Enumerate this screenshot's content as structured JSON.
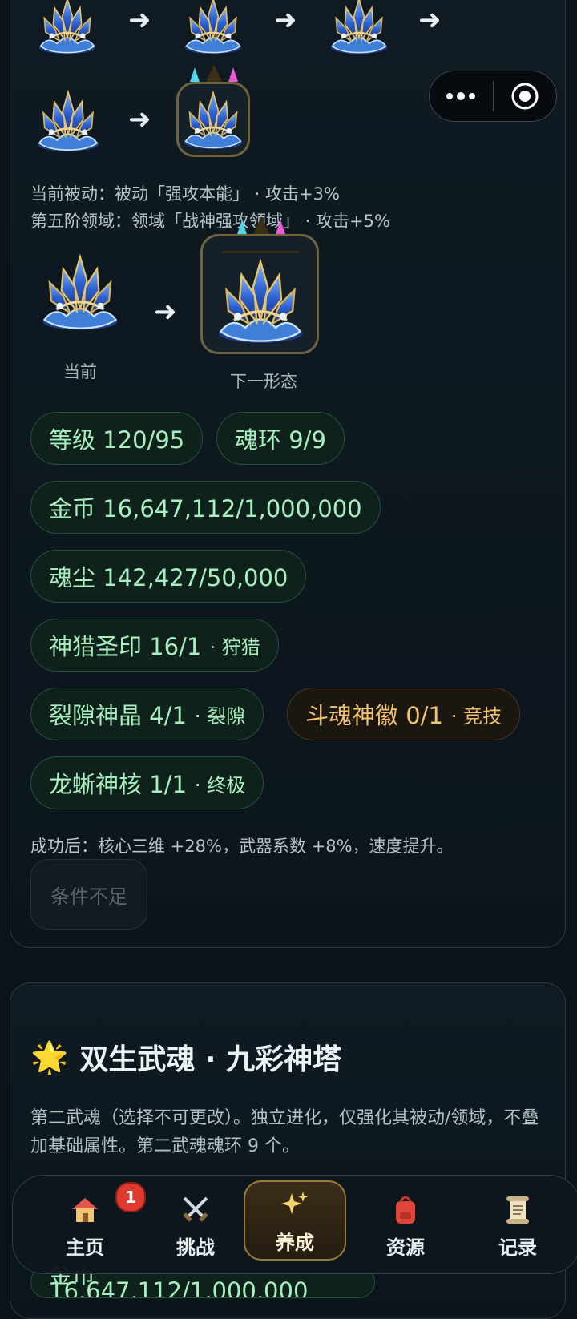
{
  "info": {
    "passive": "当前被动：被动「强攻本能」 · 攻击+3%",
    "domain5": "第五阶领域：领域「战神强攻领域」 · 攻击+5%"
  },
  "form": {
    "current_label": "当前",
    "next_label": "下一形态"
  },
  "chips": {
    "level": "等级 120/95",
    "soul_ring": "魂环 9/9",
    "gold": "金币 16,647,112/1,000,000",
    "soul_dust": "魂尘 142,427/50,000",
    "hunt_seal": {
      "label": "神猎圣印 16/1",
      "sub": "· 狩猎"
    },
    "rift_crystal": {
      "label": "裂隙神晶 4/1",
      "sub": "· 裂隙"
    },
    "arena_emblem": {
      "label": "斗魂神徽 0/1",
      "sub": "· 竞技"
    },
    "dragon_core": {
      "label": "龙蜥神核 1/1",
      "sub": "· 终极"
    }
  },
  "result_text": "成功后：核心三维 +28%，武器系数 +8%，速度提升。",
  "action_button": "条件不足",
  "section2": {
    "icon": "🌟",
    "title": "双生武魂 · 九彩神塔",
    "description": "第二武魂（选择不可更改）。独立进化，仅强化其被动/领域，不叠加基础属性。第二武魂魂环 9 个。"
  },
  "behind_nav_text": "金币 16,647,112/1,000,000",
  "nav": {
    "items": [
      {
        "label": "主页",
        "icon": "house-icon",
        "badge": "1"
      },
      {
        "label": "挑战",
        "icon": "crossed-swords-icon"
      },
      {
        "label": "养成",
        "icon": "sparkles-icon",
        "active": true
      },
      {
        "label": "资源",
        "icon": "backpack-icon"
      },
      {
        "label": "记录",
        "icon": "scroll-icon"
      }
    ]
  },
  "colors": {
    "chip_green": "#a8efc0",
    "chip_gold": "#f2c46d",
    "accent_border": "#9a7a3a",
    "badge": "#e03a30"
  }
}
